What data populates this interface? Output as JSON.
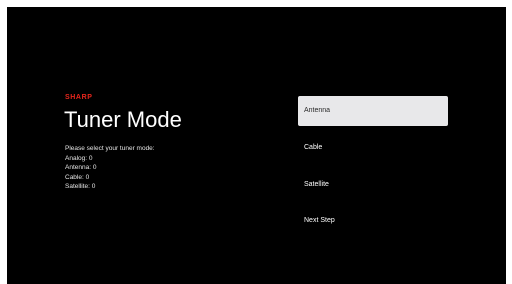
{
  "brand": {
    "name": "SHARP",
    "color": "#e8261c"
  },
  "page": {
    "title": "Tuner Mode"
  },
  "info": {
    "prompt": "Please select your tuner mode:",
    "counts": [
      "Analog: 0",
      "Antenna: 0",
      "Cable: 0",
      "Satellite: 0"
    ]
  },
  "menu": {
    "items": [
      {
        "label": "Antenna",
        "selected": true
      },
      {
        "label": "Cable",
        "selected": false
      },
      {
        "label": "Satellite",
        "selected": false
      },
      {
        "label": "Next Step",
        "selected": false
      }
    ]
  },
  "colors": {
    "background": "#000000",
    "selected_item_bg": "#e8e8ea",
    "selected_item_text": "#2a2a2a",
    "text": "#ffffff"
  }
}
